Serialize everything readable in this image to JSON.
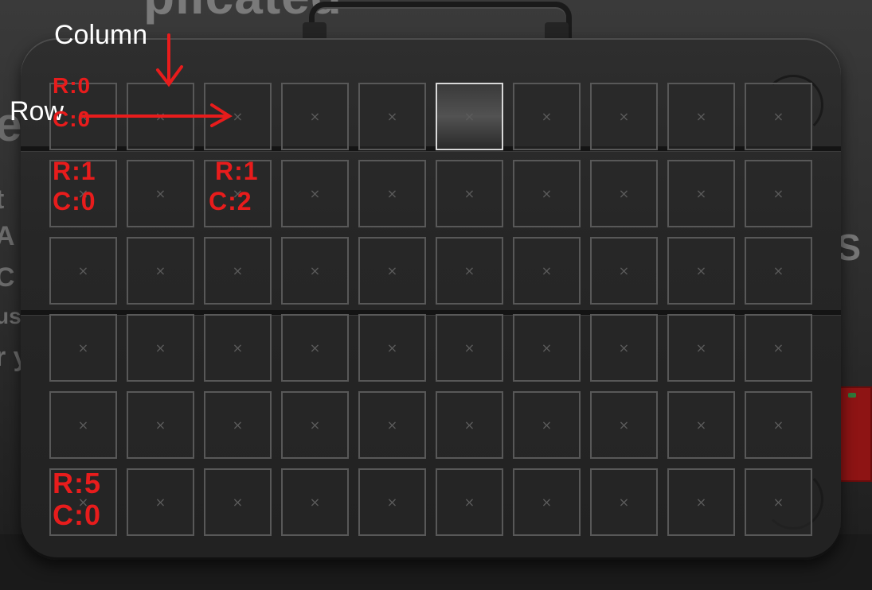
{
  "background": {
    "top_text": "plicated",
    "left_text": [
      "e",
      "t",
      "A",
      "C",
      "us",
      "r y"
    ],
    "right_text": "S"
  },
  "inventory": {
    "rows": 6,
    "columns": 10,
    "slot_glyph": "×",
    "selected_slot": {
      "row": 0,
      "column": 5
    }
  },
  "annotations": {
    "column_label": "Column",
    "row_label": "Row",
    "cell_labels": [
      {
        "row_text": "R:0",
        "col_text": "C:0"
      },
      {
        "row_text": "R:1",
        "col_text": "C:0"
      },
      {
        "row_text": "R:1",
        "col_text": "C:2"
      },
      {
        "row_text": "R:5",
        "col_text": "C:0"
      }
    ]
  },
  "colors": {
    "annotation_red": "#e81c1c",
    "slot_border": "#585858",
    "selected_border": "#d8d8d8"
  }
}
